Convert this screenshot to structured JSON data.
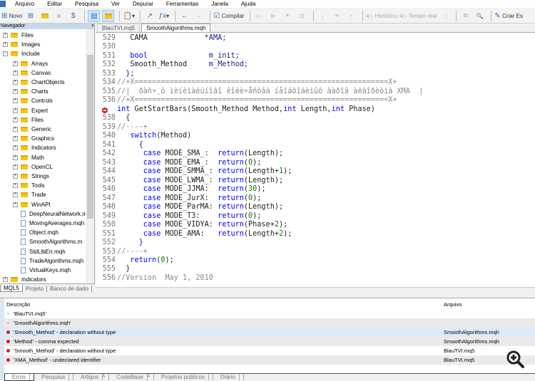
{
  "menu": [
    "Arquivo",
    "Editar",
    "Pesquisa",
    "Ver",
    "Depurar",
    "Ferramentas",
    "Janela",
    "Ajuda"
  ],
  "toolbar": {
    "new": "Novo",
    "compile": "Compilar",
    "history": "Histórico",
    "realtime": "Tempo real",
    "create": "Criar Es"
  },
  "navigator": {
    "title": "Navegador",
    "close": "×",
    "items": [
      {
        "label": "Files",
        "type": "folder",
        "level": 0,
        "exp": "+"
      },
      {
        "label": "Images",
        "type": "folder",
        "level": 0,
        "exp": "+"
      },
      {
        "label": "Include",
        "type": "folder",
        "level": 0,
        "exp": "-"
      },
      {
        "label": "Arrays",
        "type": "folder",
        "level": 1,
        "exp": "+"
      },
      {
        "label": "Canvas",
        "type": "folder",
        "level": 1,
        "exp": "+"
      },
      {
        "label": "ChartObjects",
        "type": "folder",
        "level": 1,
        "exp": "+"
      },
      {
        "label": "Charts",
        "type": "folder",
        "level": 1,
        "exp": "+"
      },
      {
        "label": "Controls",
        "type": "folder",
        "level": 1,
        "exp": "+"
      },
      {
        "label": "Expert",
        "type": "folder",
        "level": 1,
        "exp": "+"
      },
      {
        "label": "Files",
        "type": "folder",
        "level": 1,
        "exp": "+"
      },
      {
        "label": "Generic",
        "type": "folder",
        "level": 1,
        "exp": "+"
      },
      {
        "label": "Graphics",
        "type": "folder",
        "level": 1,
        "exp": "+"
      },
      {
        "label": "Indicators",
        "type": "folder",
        "level": 1,
        "exp": "+"
      },
      {
        "label": "Math",
        "type": "folder",
        "level": 1,
        "exp": "+"
      },
      {
        "label": "OpenCL",
        "type": "folder",
        "level": 1,
        "exp": "+"
      },
      {
        "label": "Strings",
        "type": "folder",
        "level": 1,
        "exp": "+"
      },
      {
        "label": "Tools",
        "type": "folder",
        "level": 1,
        "exp": "+"
      },
      {
        "label": "Trade",
        "type": "folder",
        "level": 1,
        "exp": "+"
      },
      {
        "label": "WinAPI",
        "type": "folder",
        "level": 1,
        "exp": "+"
      },
      {
        "label": "DeepNeuralNetwork.m",
        "type": "file",
        "level": 1
      },
      {
        "label": "MovingAverages.mqh",
        "type": "file",
        "level": 1
      },
      {
        "label": "Object.mqh",
        "type": "file",
        "level": 1
      },
      {
        "label": "SmoothAlgorithms.m",
        "type": "file",
        "level": 1
      },
      {
        "label": "StdLibErr.mqh",
        "type": "file",
        "level": 1
      },
      {
        "label": "TradeAlgorithms.mqh",
        "type": "file",
        "level": 1
      },
      {
        "label": "VirtualKeys.mqh",
        "type": "file",
        "level": 1
      },
      {
        "label": "Indicators",
        "type": "folder",
        "level": 0,
        "exp": "+"
      }
    ],
    "tabs": [
      "MQL5",
      "Projeto",
      "Banco de dado"
    ]
  },
  "editor": {
    "tabs": [
      "BlauTVI.mq5",
      "SmoothAlgorithms.mqh"
    ],
    "active_tab": 1,
    "lines": [
      {
        "n": "529",
        "seg": [
          [
            "t",
            "   CAMA             "
          ],
          [
            "p",
            "*AMA;"
          ]
        ]
      },
      {
        "n": "530",
        "seg": []
      },
      {
        "n": "531",
        "seg": [
          [
            "k",
            "   bool"
          ],
          [
            "p",
            "              m_init;"
          ]
        ]
      },
      {
        "n": "532",
        "seg": [
          [
            "t",
            "   Smooth_Method"
          ],
          [
            "p",
            "     m_Method;"
          ]
        ]
      },
      {
        "n": "533",
        "seg": [
          [
            "p",
            "  };"
          ]
        ]
      },
      {
        "n": "534",
        "seg": [
          [
            "c",
            "//+X==========================================================X+"
          ]
        ]
      },
      {
        "n": "535",
        "seg": [
          [
            "c",
            "//|  ðàñ÷¸ò ìèíèìàëüíîãî êîëè÷åñòâà íåîáõîäèìûõ äàðîâ àëãîðèòìà XMA  |"
          ]
        ]
      },
      {
        "n": "536",
        "seg": [
          [
            "c",
            "//+X==========================================================X+"
          ]
        ]
      },
      {
        "n": "",
        "err": true,
        "seg": [
          [
            "k",
            "int"
          ],
          [
            "t",
            " GetStartBars(Smooth_Method Method,"
          ],
          [
            "k",
            "int"
          ],
          [
            "t",
            " Length,"
          ],
          [
            "k",
            "int"
          ],
          [
            "t",
            " Phase)"
          ]
        ]
      },
      {
        "n": "538",
        "seg": [
          [
            "p",
            "  {"
          ]
        ]
      },
      {
        "n": "539",
        "seg": [
          [
            "c",
            "//----+"
          ]
        ]
      },
      {
        "n": "540",
        "seg": [
          [
            "k",
            "   switch"
          ],
          [
            "t",
            "(Method)"
          ]
        ]
      },
      {
        "n": "541",
        "seg": [
          [
            "p",
            "     {"
          ]
        ]
      },
      {
        "n": "542",
        "seg": [
          [
            "k",
            "      case"
          ],
          [
            "t",
            " MODE_SMA_:  "
          ],
          [
            "k",
            "return"
          ],
          [
            "t",
            "(Length);"
          ]
        ]
      },
      {
        "n": "543",
        "seg": [
          [
            "k",
            "      case"
          ],
          [
            "t",
            " MODE_EMA_:  "
          ],
          [
            "k",
            "return"
          ],
          [
            "t",
            "("
          ],
          [
            "n",
            "0"
          ],
          [
            "t",
            ");"
          ]
        ]
      },
      {
        "n": "544",
        "seg": [
          [
            "k",
            "      case"
          ],
          [
            "t",
            " MODE_SMMA_: "
          ],
          [
            "k",
            "return"
          ],
          [
            "t",
            "(Length+"
          ],
          [
            "n",
            "1"
          ],
          [
            "t",
            ");"
          ]
        ]
      },
      {
        "n": "545",
        "seg": [
          [
            "k",
            "      case"
          ],
          [
            "t",
            " MODE_LWMA_: "
          ],
          [
            "k",
            "return"
          ],
          [
            "t",
            "(Length);"
          ]
        ]
      },
      {
        "n": "546",
        "seg": [
          [
            "k",
            "      case"
          ],
          [
            "t",
            " MODE_JJMA:  "
          ],
          [
            "k",
            "return"
          ],
          [
            "t",
            "("
          ],
          [
            "n",
            "30"
          ],
          [
            "t",
            ");"
          ]
        ]
      },
      {
        "n": "547",
        "seg": [
          [
            "k",
            "      case"
          ],
          [
            "t",
            " MODE_JurX:  "
          ],
          [
            "k",
            "return"
          ],
          [
            "t",
            "("
          ],
          [
            "n",
            "0"
          ],
          [
            "t",
            ");"
          ]
        ]
      },
      {
        "n": "548",
        "seg": [
          [
            "k",
            "      case"
          ],
          [
            "t",
            " MODE_ParMA: "
          ],
          [
            "k",
            "return"
          ],
          [
            "t",
            "(Length);"
          ]
        ]
      },
      {
        "n": "549",
        "seg": [
          [
            "k",
            "      case"
          ],
          [
            "t",
            " MODE_T3:    "
          ],
          [
            "k",
            "return"
          ],
          [
            "t",
            "("
          ],
          [
            "n",
            "0"
          ],
          [
            "t",
            ");"
          ]
        ]
      },
      {
        "n": "550",
        "seg": [
          [
            "k",
            "      case"
          ],
          [
            "t",
            " MODE_VIDYA: "
          ],
          [
            "k",
            "return"
          ],
          [
            "t",
            "(Phase+"
          ],
          [
            "n",
            "2"
          ],
          [
            "t",
            ");"
          ]
        ]
      },
      {
        "n": "551",
        "seg": [
          [
            "k",
            "      case"
          ],
          [
            "t",
            " MODE_AMA:   "
          ],
          [
            "k",
            "return"
          ],
          [
            "t",
            "(Length+"
          ],
          [
            "n",
            "2"
          ],
          [
            "t",
            ");"
          ]
        ]
      },
      {
        "n": "552",
        "seg": [
          [
            "p",
            "     }"
          ]
        ]
      },
      {
        "n": "553",
        "seg": [
          [
            "c",
            "//----+"
          ]
        ]
      },
      {
        "n": "554",
        "seg": [
          [
            "k",
            "   return"
          ],
          [
            "t",
            "("
          ],
          [
            "n",
            "0"
          ],
          [
            "t",
            ");"
          ]
        ]
      },
      {
        "n": "555",
        "seg": [
          [
            "p",
            "  }"
          ]
        ]
      },
      {
        "n": "556",
        "seg": [
          [
            "c",
            "//Version  May 1, 2010"
          ]
        ]
      }
    ]
  },
  "errors": {
    "headers": [
      "Descrição",
      "Arquivo"
    ],
    "rows": [
      {
        "type": "file",
        "desc": "'BlauTVI.mq5'",
        "file": ""
      },
      {
        "type": "file",
        "desc": "'SmoothAlgorithms.mqh'",
        "file": ""
      },
      {
        "type": "error",
        "desc": "'Smooth_Method' - declaration without type",
        "file": "SmoothAlgorithms.mqh"
      },
      {
        "type": "error",
        "desc": "'Method' - comma expected",
        "file": "SmoothAlgorithms.mqh"
      },
      {
        "type": "error",
        "desc": "'Smooth_Method' - declaration without type",
        "file": "BlauTVI.mq5"
      },
      {
        "type": "error",
        "desc": "'XMA_Method' - undeclared identifier",
        "file": "BlauTVI.mq5"
      }
    ],
    "tabs": [
      {
        "label": "Erros"
      },
      {
        "label": "Pesquisa"
      },
      {
        "label": "Artigos",
        "badge": "1"
      },
      {
        "label": "CodeBase",
        "badge": "1"
      },
      {
        "label": "Projetos públicos"
      },
      {
        "label": "Diário"
      }
    ]
  },
  "colors": {
    "error": "#d42121",
    "keyword": "#0000ff",
    "comment": "#888888",
    "number": "#008000",
    "selected_row": "#dcebf8"
  }
}
